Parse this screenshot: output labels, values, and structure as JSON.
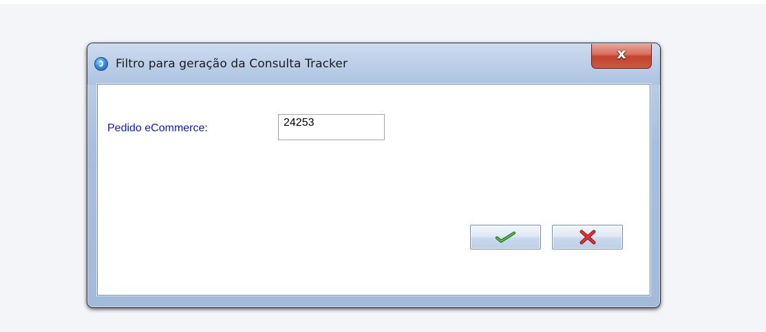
{
  "dialog": {
    "title": "Filtro para geração da Consulta Tracker",
    "close_glyph": "x",
    "icon": "app-globe-icon"
  },
  "form": {
    "pedido_label": "Pedido eCommerce:",
    "pedido_value": "24253"
  },
  "buttons": {
    "ok_icon": "check-icon",
    "cancel_icon": "x-icon"
  },
  "colors": {
    "label": "#0f16e6",
    "check": "#3a9a2e",
    "cross": "#d8232a",
    "close_button": "#c3432e"
  }
}
